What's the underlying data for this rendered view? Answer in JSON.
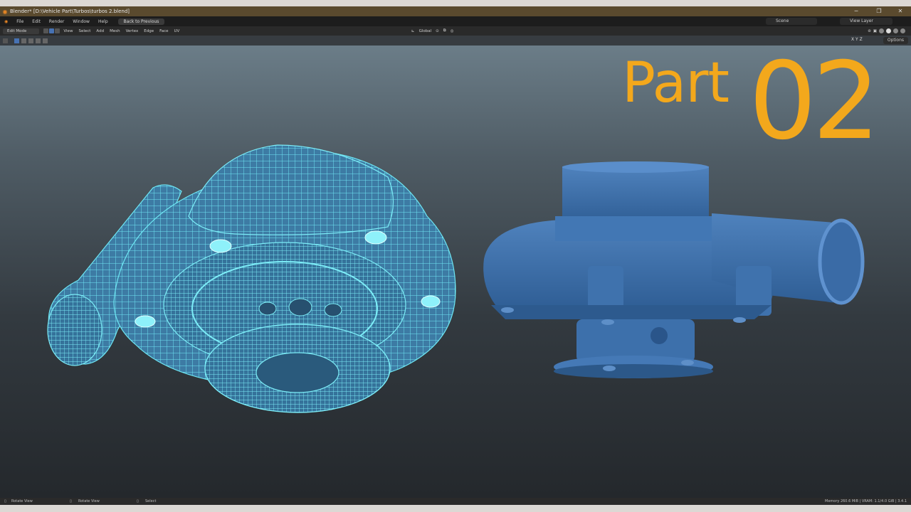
{
  "window": {
    "title": "Blender* [D:\\Vehicle Part\\Turbos\\turbos 2.blend]",
    "controls": [
      "─",
      "❐",
      "✕"
    ]
  },
  "menubar": {
    "items": [
      "File",
      "Edit",
      "Render",
      "Window",
      "Help"
    ],
    "back_button": "Back to Previous",
    "scene": "Scene",
    "view_layer": "View Layer"
  },
  "header": {
    "mode": "Edit Mode",
    "menus": [
      "View",
      "Select",
      "Add",
      "Mesh",
      "Vertex",
      "Edge",
      "Face",
      "UV"
    ],
    "transform_orientation": "Global"
  },
  "toolbar": {
    "options_label": "Options",
    "axes": [
      "X",
      "Y",
      "Z"
    ]
  },
  "overlay": {
    "title_word": "Part",
    "title_number": "02"
  },
  "statusbar": {
    "hints": [
      "Rotate View",
      "Rotate View",
      "Select"
    ],
    "memory": "Memory 260.6 MiB | VRAM: 1.1/4.0 GiB | 3.4.1"
  },
  "colors": {
    "accent": "#f3a81c",
    "wireframe": "#5fd8e8",
    "solid_model": "#3f6fa6",
    "titlebar": "#5a4a2e"
  }
}
